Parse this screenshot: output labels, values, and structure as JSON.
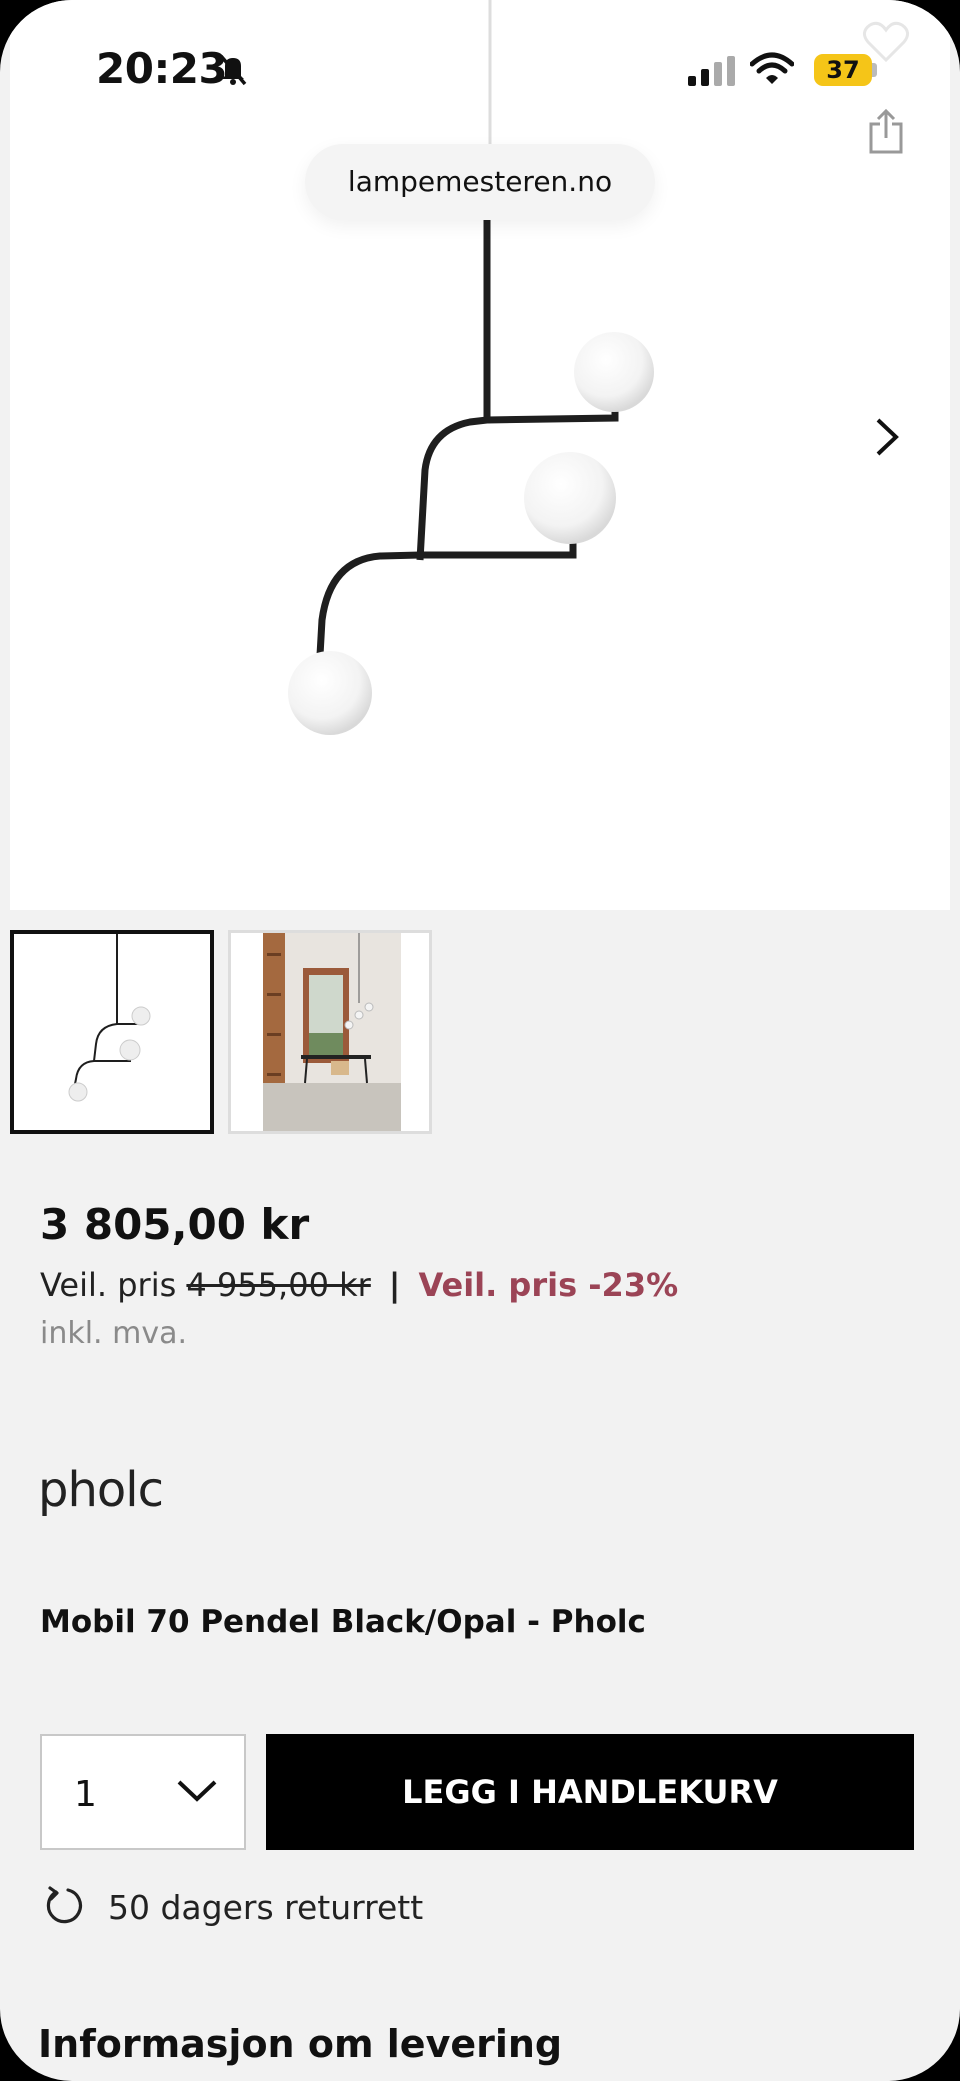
{
  "status_bar": {
    "time": "20:23",
    "battery": "37"
  },
  "browser": {
    "url": "lampemesteren.no"
  },
  "product": {
    "price": "3 805,00 kr",
    "rrp_label": "Veil. pris",
    "rrp_old": "4 955,00 kr",
    "separator": "|",
    "discount": "Veil. pris -23%",
    "vat_note": "inkl. mva.",
    "brand": "pholc",
    "title": "Mobil 70 Pendel Black/Opal - Pholc"
  },
  "purchase": {
    "quantity": "1",
    "add_to_cart": "LEGG I HANDLEKURV"
  },
  "returns": {
    "text": "50 dagers returrett"
  },
  "delivery": {
    "heading": "Informasjon om levering"
  },
  "colors": {
    "discount": "#9b4456",
    "button": "#000000",
    "battery": "#f5c518"
  },
  "icons": [
    "bell-off-icon",
    "signal-icon",
    "wifi-icon",
    "heart-icon",
    "share-icon",
    "chevron-right-icon",
    "chevron-down-icon",
    "return-icon"
  ]
}
